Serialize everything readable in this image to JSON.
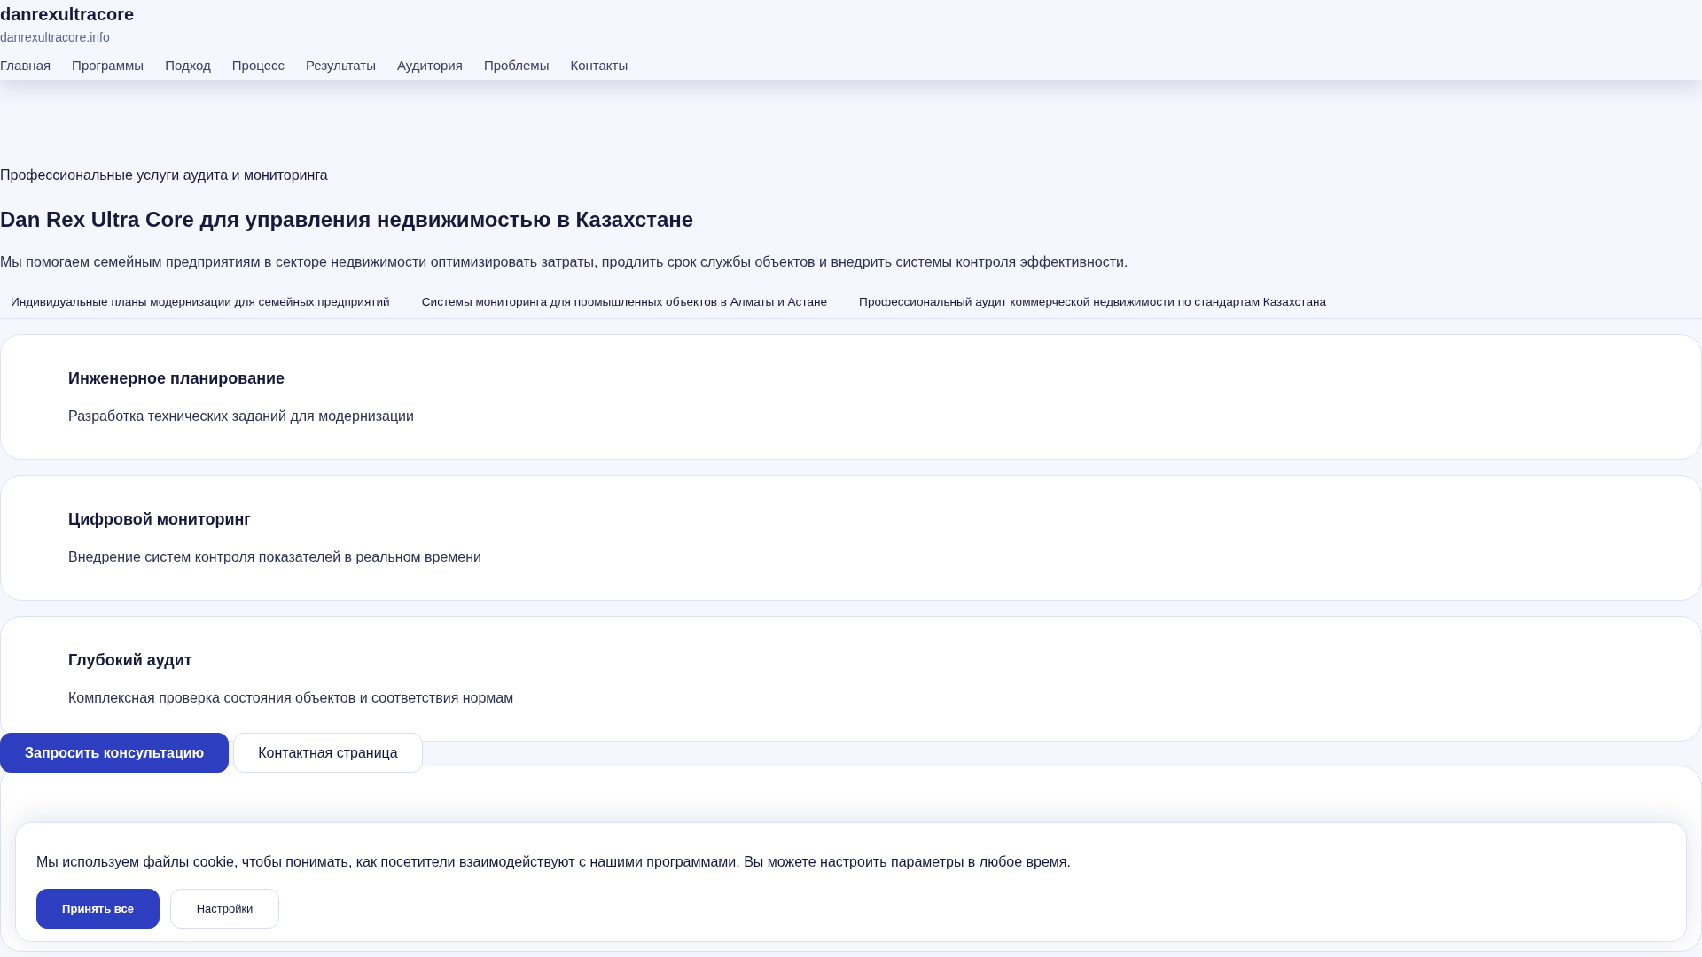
{
  "header": {
    "title": "danrexultracore",
    "domain": "danrexultracore.info"
  },
  "nav": [
    {
      "label": "Главная"
    },
    {
      "label": "Программы"
    },
    {
      "label": "Подход"
    },
    {
      "label": "Процесс"
    },
    {
      "label": "Результаты"
    },
    {
      "label": "Аудитория"
    },
    {
      "label": "Проблемы"
    },
    {
      "label": "Контакты"
    }
  ],
  "hero": {
    "eyebrow": "Профессиональные услуги аудита и мониторинга",
    "heading": "Dan Rex Ultra Core для управления недвижимостью в Казахстане",
    "lead": "Мы помогаем семейным предприятиям в секторе недвижимости оптимизировать затраты, продлить срок службы объектов и внедрить системы контроля эффективности."
  },
  "tags": [
    "Индивидуальные планы модернизации для семейных предприятий",
    "Системы мониторинга для промышленных объектов в Алматы и Астане",
    "Профессиональный аудит коммерческой недвижимости по стандартам Казахстана"
  ],
  "cards": [
    {
      "title": "Инженерное планирование",
      "text": "Разработка технических заданий для модернизации"
    },
    {
      "title": "Цифровой мониторинг",
      "text": "Внедрение систем контроля показателей в реальном времени"
    },
    {
      "title": "Глубокий аудит",
      "text": "Комплексная проверка состояния объектов и соответствия нормам"
    }
  ],
  "actions": [
    {
      "label": "Запросить консультацию",
      "kind": "primary"
    },
    {
      "label": "Контактная страница",
      "kind": "secondary"
    }
  ],
  "cookie_banner": {
    "text": "Мы используем файлы cookie, чтобы понимать, как посетители взаимодействуют с нашими программами. Вы можете настроить параметры в любое время.",
    "buttons": [
      {
        "label": "Принять все",
        "kind": "primary"
      },
      {
        "label": "Настройки",
        "kind": "secondary"
      }
    ]
  }
}
